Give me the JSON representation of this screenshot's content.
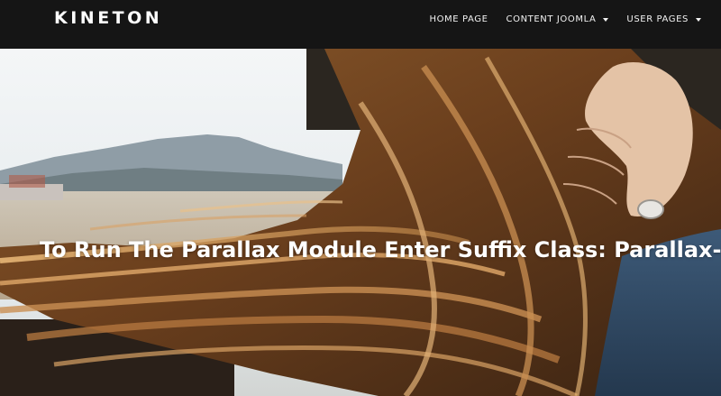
{
  "brand": {
    "logo_text": "KINETON"
  },
  "nav": {
    "items": [
      {
        "label": "HOME PAGE",
        "has_dropdown": false
      },
      {
        "label": "CONTENT JOOMLA",
        "has_dropdown": true
      },
      {
        "label": "USER PAGES",
        "has_dropdown": true
      }
    ]
  },
  "hero": {
    "title": "To Run The Parallax Module Enter Suffix Class: Parallax-h"
  },
  "colors": {
    "header_bg": "#151515",
    "nav_text": "#f2f2f2",
    "hero_text": "#ffffff"
  }
}
